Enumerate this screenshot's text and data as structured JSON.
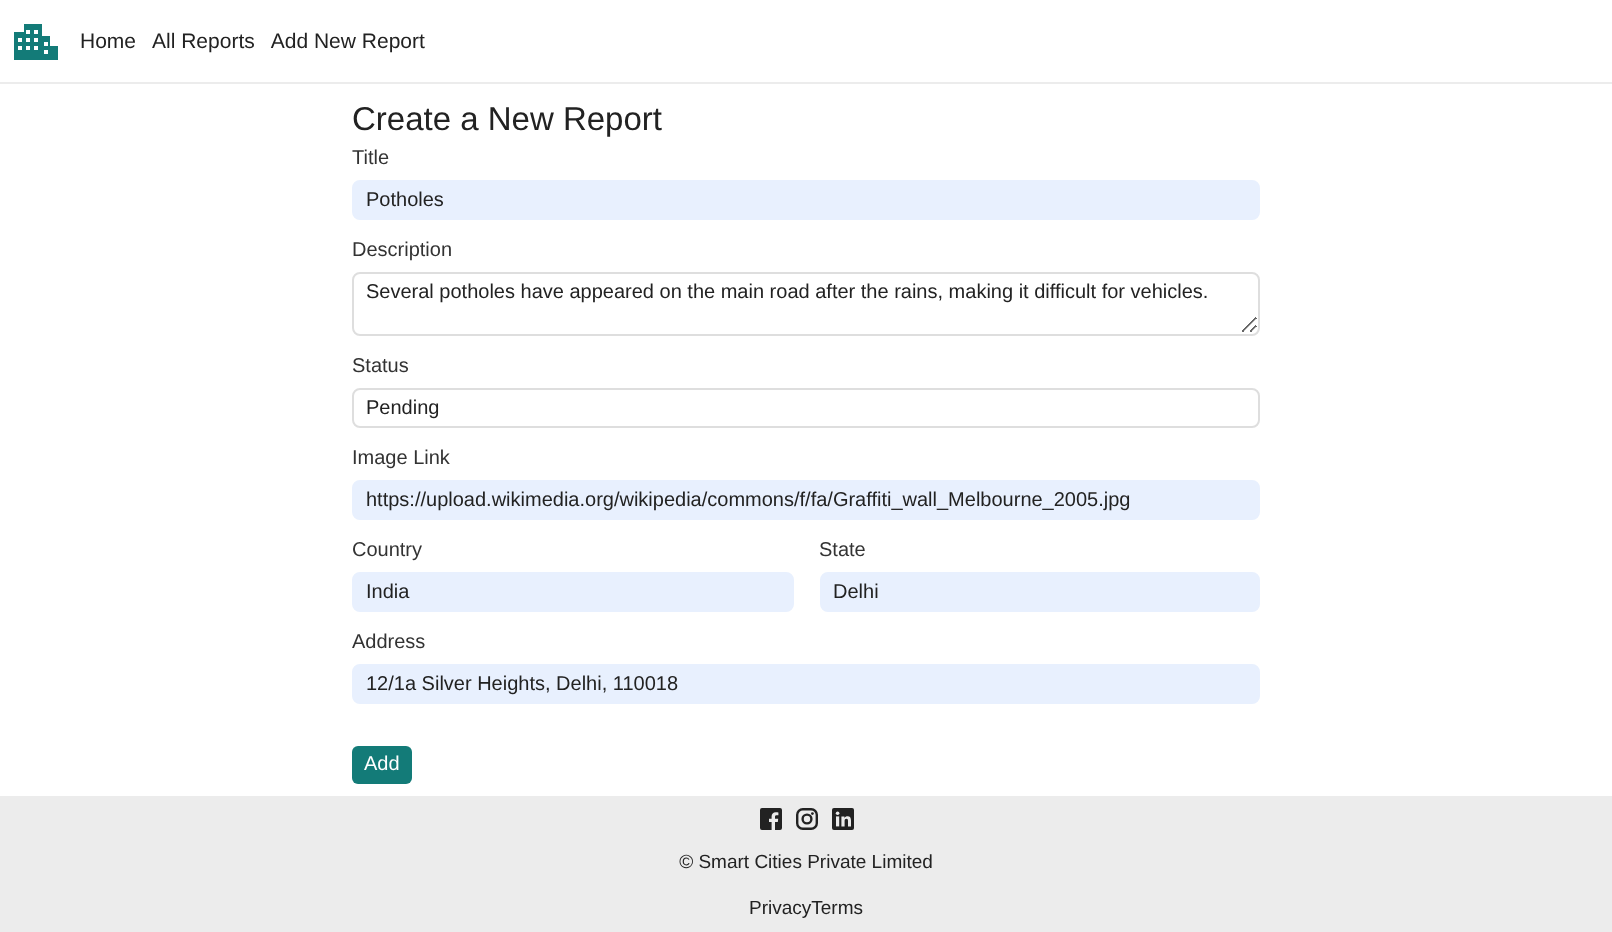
{
  "nav": {
    "links": [
      "Home",
      "All Reports",
      "Add New Report"
    ]
  },
  "form": {
    "heading": "Create a New Report",
    "fields": [
      {
        "label": "Title",
        "value": "Potholes",
        "kind": "input",
        "autofill": true,
        "half": false
      },
      {
        "label": "Description",
        "value": "Several potholes have appeared on the main road after the rains, making it difficult for vehicles.",
        "kind": "textarea",
        "autofill": false,
        "half": false
      },
      {
        "label": "Status",
        "value": "Pending",
        "kind": "input",
        "autofill": false,
        "half": false
      },
      {
        "label": "Image Link",
        "value": "https://upload.wikimedia.org/wikipedia/commons/f/fa/Graffiti_wall_Melbourne_2005.jpg",
        "kind": "input",
        "autofill": true,
        "half": false
      },
      {
        "label": "Country",
        "value": "India",
        "kind": "input",
        "autofill": true,
        "half": true
      },
      {
        "label": "State",
        "value": "Delhi",
        "kind": "input",
        "autofill": true,
        "half": true
      },
      {
        "label": "Address",
        "value": "12/1a Silver Heights, Delhi, 110018",
        "kind": "input",
        "autofill": true,
        "half": false
      }
    ],
    "submit": "Add"
  },
  "footer": {
    "social": [
      {
        "kind": "facebook"
      },
      {
        "kind": "instagram"
      },
      {
        "kind": "linkedin"
      }
    ],
    "copyright": "© Smart Cities Private Limited",
    "links": [
      "Privacy",
      "Terms"
    ]
  }
}
